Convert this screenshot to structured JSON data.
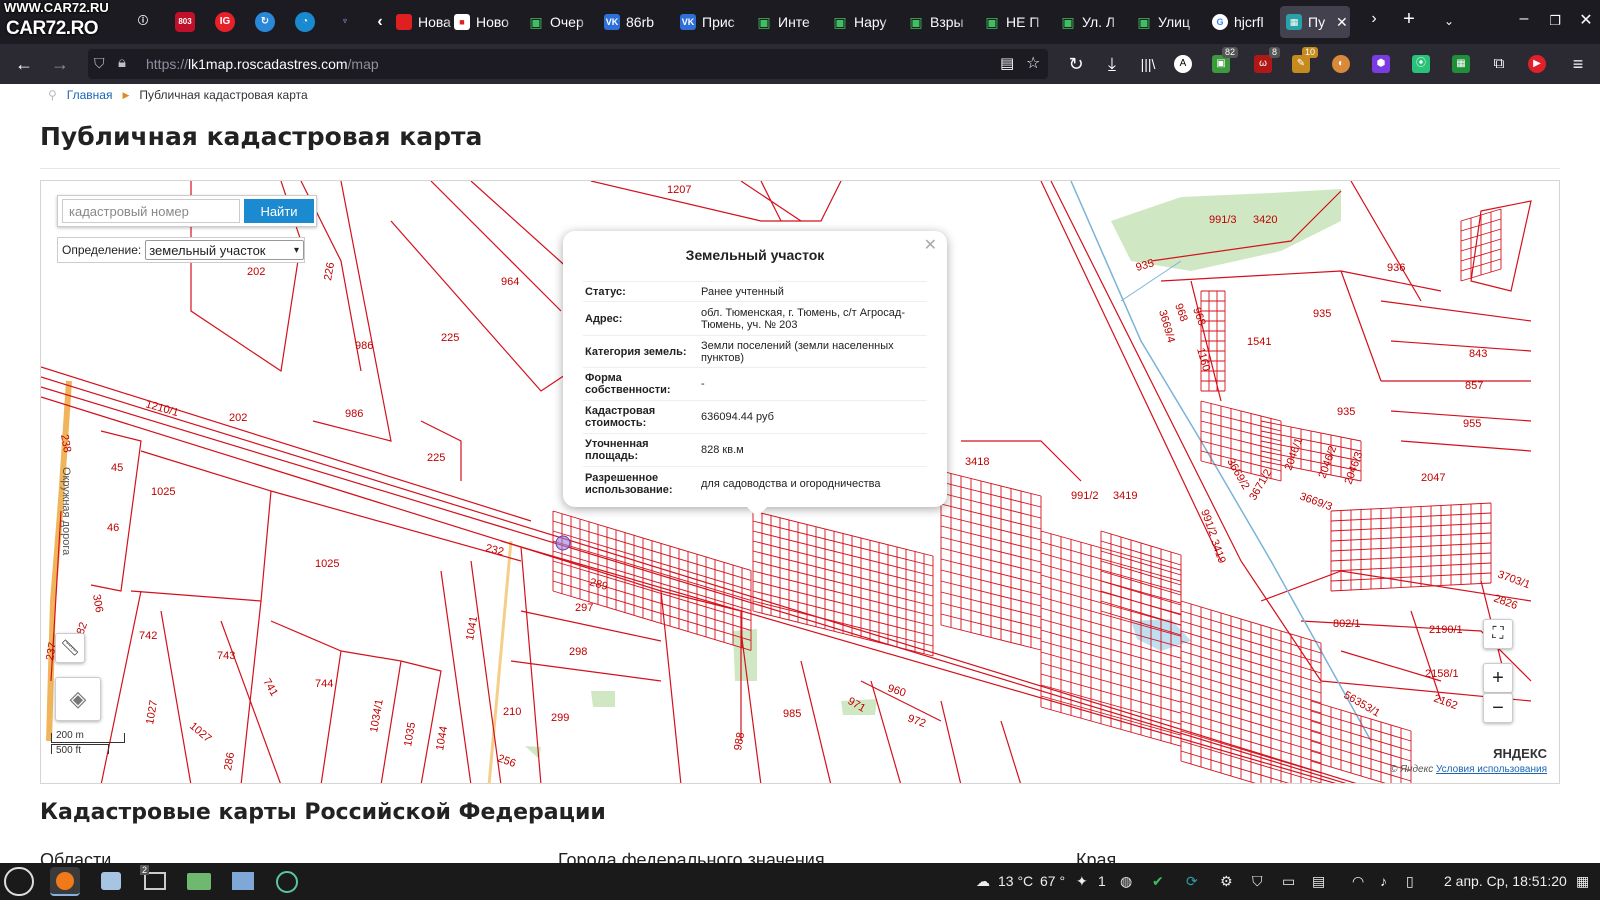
{
  "watermark": {
    "line1": "WWW.CAR72.RU",
    "line2": "CAR72.RO"
  },
  "tabs": [
    {
      "title": "Нова",
      "icon": "red-square-icon",
      "color": "#e02020"
    },
    {
      "title": "Ново",
      "icon": "monitor-icon",
      "color": "#3fbf5f"
    },
    {
      "title": "Очер",
      "icon": "monitor-icon",
      "color": "#3fbf5f"
    },
    {
      "title": "86rb",
      "icon": "vk-icon",
      "color": "#2f6fd8"
    },
    {
      "title": "Прис",
      "icon": "vk-icon",
      "color": "#2f6fd8"
    },
    {
      "title": "Инте",
      "icon": "monitor-icon",
      "color": "#3fbf5f"
    },
    {
      "title": "Нару",
      "icon": "monitor-icon",
      "color": "#3fbf5f"
    },
    {
      "title": "Взры",
      "icon": "monitor-icon",
      "color": "#3fbf5f"
    },
    {
      "title": "НЕ П",
      "icon": "monitor-icon",
      "color": "#3fbf5f"
    },
    {
      "title": "Ул. Л",
      "icon": "monitor-icon",
      "color": "#3fbf5f"
    },
    {
      "title": "Улиц",
      "icon": "monitor-icon",
      "color": "#3fbf5f"
    },
    {
      "title": "hjcrfl",
      "icon": "google-icon",
      "color": "#ffffff"
    },
    {
      "title": "Пу",
      "icon": "cadastre-icon",
      "color": "#2aa0a8"
    }
  ],
  "address_bar": {
    "scheme": "https://",
    "host": "lk1map.roscadastres.com",
    "path": "/map"
  },
  "extension_badges": {
    "a": "82",
    "b": "8",
    "c": "10"
  },
  "breadcrumb": {
    "home": "Главная",
    "current": "Публичная кадастровая карта"
  },
  "page_title": "Публичная кадастровая карта",
  "search": {
    "placeholder": "кадастровый номер",
    "button": "Найти"
  },
  "definition": {
    "label": "Определение:",
    "value": "земельный участок"
  },
  "popup": {
    "title": "Земельный участок",
    "rows": [
      {
        "key": "Статус:",
        "value": "Ранее учтенный"
      },
      {
        "key": "Адрес:",
        "value": "обл. Тюменская, г. Тюмень, с/т Агросад-Тюмень, уч. № 203"
      },
      {
        "key": "Категория земель:",
        "value": "Земли поселений (земли населенных пунктов)"
      },
      {
        "key": "Форма собственности:",
        "value": "-"
      },
      {
        "key": "Кадастровая стоимость:",
        "value": "636094.44 руб"
      },
      {
        "key": "Уточненная площадь:",
        "value": "828 кв.м"
      },
      {
        "key": "Разрешенное использование:",
        "value": "для садоводства и огородничества"
      }
    ]
  },
  "map_labels": {
    "l1207": "1207",
    "l964": "964",
    "l202a": "202",
    "l226": "226",
    "l986a": "986",
    "l225a": "225",
    "l202b": "202",
    "l986b": "986",
    "l1210": "1210/1",
    "l225b": "225",
    "l45": "45",
    "l1025a": "1025",
    "l46": "46",
    "l1025b": "1025",
    "l232": "232",
    "l289": "289",
    "l297": "297",
    "l298": "298",
    "l742": "742",
    "l743": "743",
    "l744": "744",
    "l741": "741",
    "l1041": "1041",
    "l306": "306",
    "l238": "238",
    "l282": "282",
    "l237": "237",
    "l1027a": "1027",
    "l1027b": "1027",
    "l1034": "1034/1",
    "l1035": "1035",
    "l1044": "1044",
    "l210": "210",
    "l299": "299",
    "l256": "256",
    "l286": "286",
    "l985": "985",
    "l988": "988",
    "l971": "971",
    "l960": "960",
    "l972": "972",
    "l3418": "3418",
    "l9912a": "991/2",
    "l3419a": "3419",
    "l9912b": "991/2",
    "l3419b": "3419",
    "l9913": "991/3",
    "l3420": "3420",
    "l935a": "935",
    "l936": "936",
    "l935b": "935",
    "l1541": "1541",
    "l843": "843",
    "l857": "857",
    "l935c": "935",
    "l955": "955",
    "l3669": "3669/4",
    "l968a": "968",
    "l968b": "968",
    "l1160": "1160",
    "l20461": "2046/1",
    "l20462": "2046/2",
    "l20463": "2046/3",
    "l36692": "3669/2",
    "l36712": "3671/2",
    "l36693": "3669/3",
    "l2047": "2047",
    "l8021": "802/1",
    "l21901": "2190/1",
    "l21581": "2158/1",
    "l2162": "2162",
    "l56353": "56353/1",
    "l37031": "3703/1",
    "l2826": "2826",
    "road": "Окружная дорога"
  },
  "map_controls": {
    "scale_m": "200 m",
    "scale_ft": "500 ft",
    "zoom_in": "+",
    "zoom_out": "−"
  },
  "attribution": {
    "brand": "ЯНДЕКС",
    "copyright": "© Яндекс",
    "terms": "Условия использования"
  },
  "section_title": "Кадастровые карты Российской Федерации",
  "region_columns": [
    "Области",
    "Города федерального значения",
    "Края"
  ],
  "taskbar": {
    "weather": "13 °C",
    "humidity": "67 °",
    "count": "1",
    "datetime": "2 апр. Ср, 18:51:20",
    "badge": "2"
  }
}
